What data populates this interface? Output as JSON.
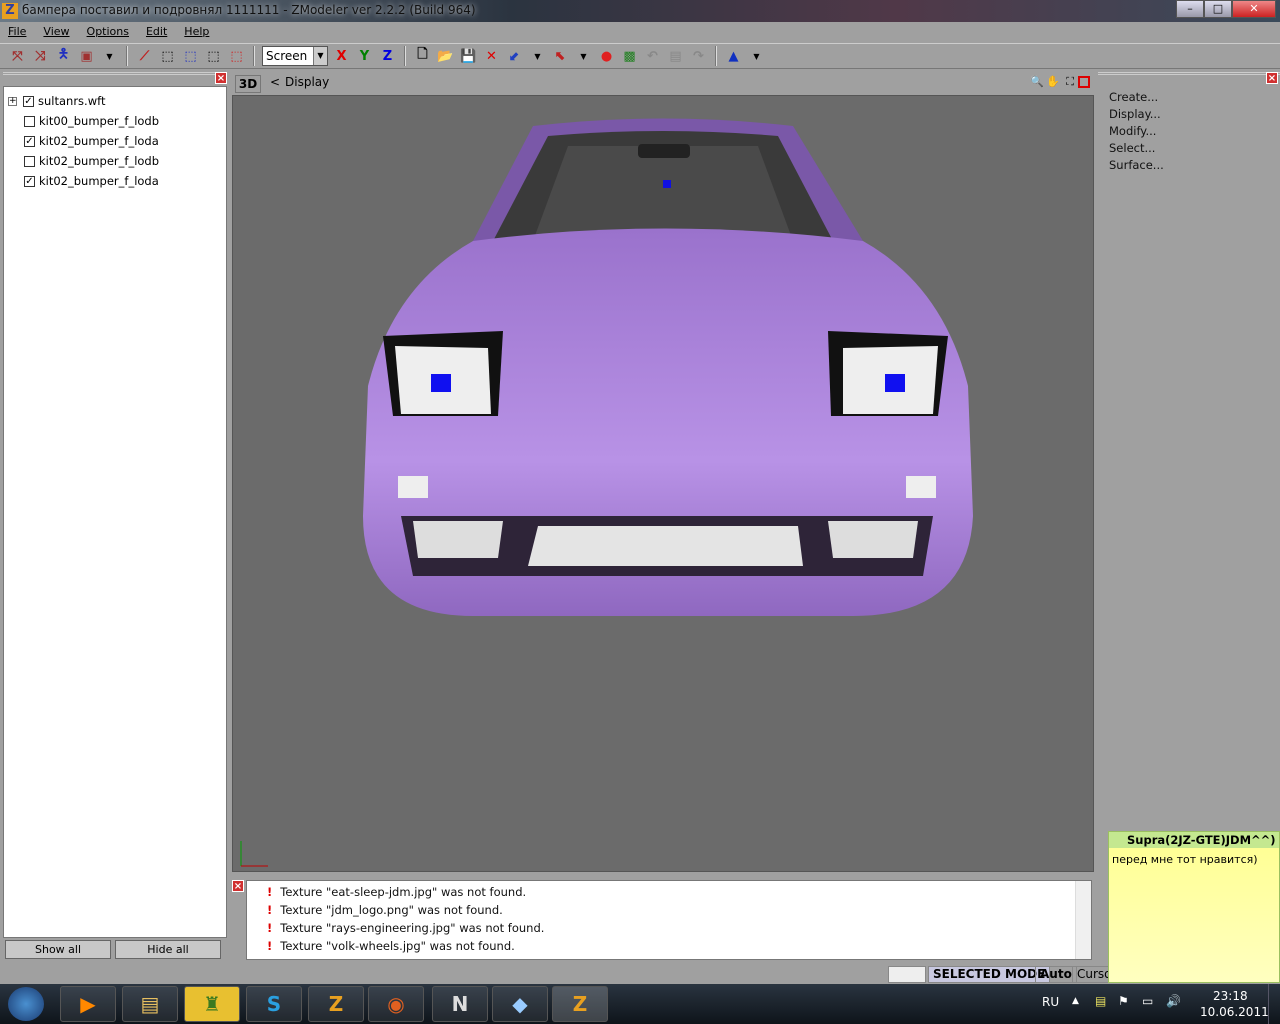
{
  "window": {
    "title": "бампера поставил и подровнял 1111111 - ZModeler ver 2.2.2 (Build 964)",
    "controls": [
      "minimize",
      "maximize",
      "close"
    ]
  },
  "menu": [
    "File",
    "View",
    "Options",
    "Edit",
    "Help"
  ],
  "toolbar": {
    "coord_system": "Screen",
    "axes": [
      "X",
      "Y",
      "Z"
    ],
    "axis_colors": {
      "X": "#e00000",
      "Y": "#008000",
      "Z": "#0000e0"
    }
  },
  "tree": {
    "items": [
      {
        "label": "sultanrs.wft",
        "checked": true,
        "expandable": true
      },
      {
        "label": "kit00_bumper_f_lodb",
        "checked": false
      },
      {
        "label": "kit02_bumper_f_loda",
        "checked": true
      },
      {
        "label": "kit02_bumper_f_lodb",
        "checked": false
      },
      {
        "label": "kit02_bumper_f_loda",
        "checked": true
      }
    ],
    "show_all": "Show all",
    "hide_all": "Hide all"
  },
  "viewport": {
    "mode": "3D",
    "back": "<",
    "title": "Display",
    "car_color": "#a77cd8",
    "background": "#6b6b6b"
  },
  "commands": [
    "Create...",
    "Display...",
    "Modify...",
    "Select...",
    "Surface..."
  ],
  "log": [
    "Texture \"eat-sleep-jdm.jpg\" was not found.",
    "Texture \"jdm_logo.png\" was not found.",
    "Texture \"rays-engineering.jpg\" was not found.",
    "Texture \"volk-wheels.jpg\" was not found."
  ],
  "status": {
    "mode": "SELECTED MODE",
    "auto": "Auto",
    "cursor": "Cursor"
  },
  "note": {
    "title": "Supra(2JZ-GTE)JDM^^)",
    "body": "перед мне тот нравится)"
  },
  "taskbar": {
    "lang": "RU",
    "time": "23:18",
    "date": "10.06.2011"
  }
}
